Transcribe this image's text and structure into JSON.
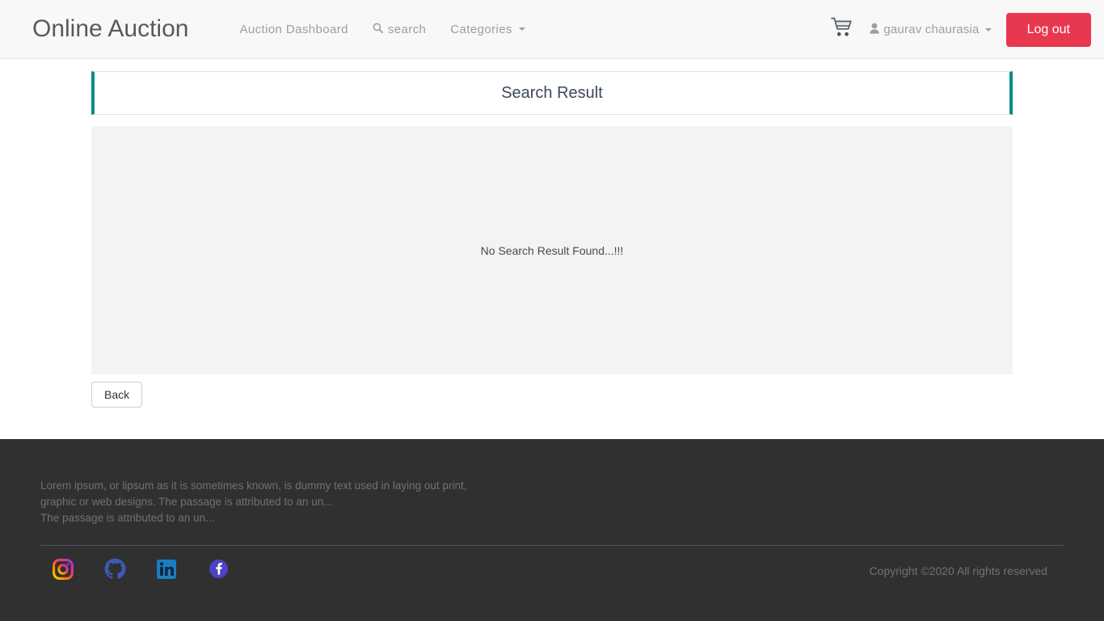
{
  "navbar": {
    "brand": "Online Auction",
    "links": [
      {
        "label": "Auction Dashboard",
        "icon": ""
      },
      {
        "label": "search",
        "icon": "search-icon"
      },
      {
        "label": "Categories",
        "icon": "caret-down-icon"
      }
    ],
    "cart_icon": "shopping-cart-icon",
    "user": {
      "icon": "user-icon",
      "name": "gaurav chaurasia"
    },
    "logout_label": "Log out",
    "logout_color": "#e8384f"
  },
  "main": {
    "panel_title": "Search Result",
    "accent_color": "#0b8b8b",
    "empty_message": "No Search Result Found...!!!",
    "back_label": "Back"
  },
  "footer": {
    "line1": "Lorem ipsum, or lipsum as it is sometimes known, is dummy text used in laying out print,",
    "line2": "graphic or web designs. The passage is attributed to an un...",
    "line3": "The passage is attributed to an un...",
    "socials": [
      {
        "name": "instagram-icon"
      },
      {
        "name": "github-icon"
      },
      {
        "name": "linkedin-icon"
      },
      {
        "name": "facebook-icon"
      }
    ],
    "copyright": "Copyright ©2020 All rights reserved"
  }
}
